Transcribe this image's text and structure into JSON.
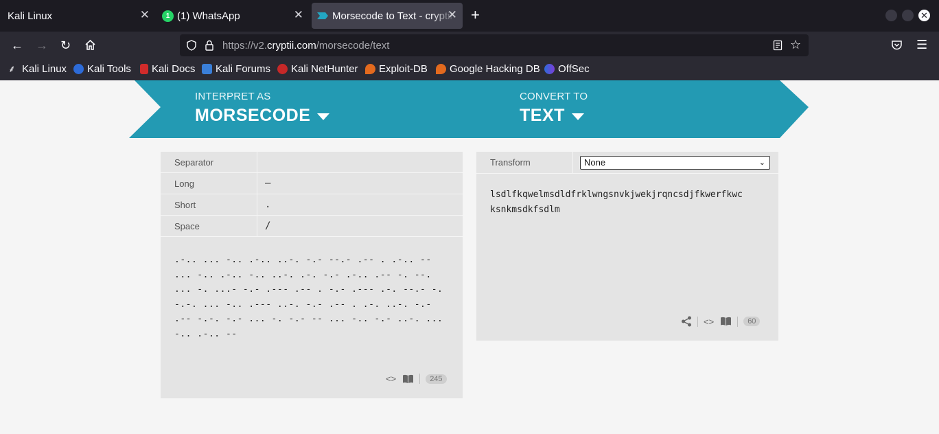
{
  "browser": {
    "tabs": [
      {
        "title": "Kali Linux",
        "active": false
      },
      {
        "title": "(1) WhatsApp",
        "badge": "1",
        "active": false
      },
      {
        "title": "Morsecode to Text - cryptii",
        "active": true
      }
    ],
    "url": {
      "scheme": "https://v2.",
      "host": "cryptii.com",
      "path": "/morsecode/text"
    },
    "bookmarks": [
      "Kali Linux",
      "Kali Tools",
      "Kali Docs",
      "Kali Forums",
      "Kali NetHunter",
      "Exploit-DB",
      "Google Hacking DB",
      "OffSec"
    ]
  },
  "banner": {
    "interpret_label": "INTERPRET AS",
    "interpret_value": "MORSECODE",
    "convert_label": "CONVERT TO",
    "convert_value": "TEXT",
    "color": "#239ab3"
  },
  "left_panel": {
    "settings": [
      {
        "label": "Separator",
        "value": ""
      },
      {
        "label": "Long",
        "value": "–"
      },
      {
        "label": "Short",
        "value": "."
      },
      {
        "label": "Space",
        "value": "/"
      }
    ],
    "morse_text": ".-.. ... -.. .-.. ..-. -.- --.- .-- . .-.. --\n... -.. .-.. -.. ..-. .-. -.- .-.. .-- -. --.\n... -. ...- -.- .--- .-- . -.- .--- .-. --.- -.\n-.-. ... -.. .--- ..-. -.- .-- . .-. ..-. -.-\n.-- -.-. -.- ... -. -.- -- ... -.. -.- ..-. ...\n-.. .-.. --",
    "count": "245"
  },
  "right_panel": {
    "transform_label": "Transform",
    "transform_value": "None",
    "output_text": "lsdlfkqwelmsdldfrklwngsnvkjwekjrqncsdjfkwerfkwc\nksnkmsdkfsdlm",
    "count": "60"
  }
}
